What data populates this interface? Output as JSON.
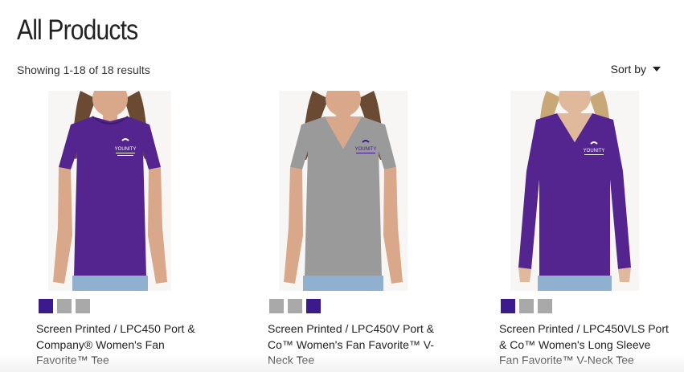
{
  "page": {
    "title": "All Products"
  },
  "toolbar": {
    "results_text": "Showing 1-18 of 18 results",
    "sort_label": "Sort by",
    "sort_icon": "caret-down-icon"
  },
  "colors": {
    "purple": "#3d1a8c",
    "gray": "#a9a9a9",
    "shirt_purple": "#54248f",
    "shirt_gray": "#9a9a9a"
  },
  "products": [
    {
      "name": "Screen Printed / LPC450 Port & Company® Women's Fan Favorite™ Tee",
      "logo_text": "YOUNITY",
      "swatches": [
        "#3d1a8c",
        "#a9a9a9",
        "#a9a9a9"
      ]
    },
    {
      "name": "Screen Printed / LPC450V Port & Co™ Women's Fan Favorite™ V-Neck Tee",
      "logo_text": "YOUNITY",
      "swatches": [
        "#a9a9a9",
        "#a9a9a9",
        "#3d1a8c"
      ]
    },
    {
      "name": "Screen Printed / LPC450VLS Port & Co™ Women's Long Sleeve Fan Favorite™ V-Neck Tee",
      "logo_text": "YOUNITY",
      "swatches": [
        "#3d1a8c",
        "#a9a9a9",
        "#a9a9a9"
      ]
    }
  ]
}
